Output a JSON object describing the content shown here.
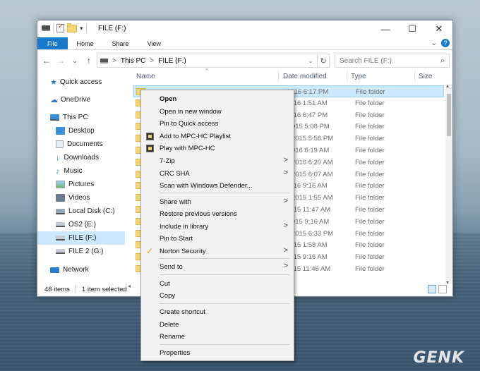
{
  "window": {
    "title": "FILE (F:)",
    "minimize": "—",
    "maximize": "☐",
    "close": "✕"
  },
  "ribbon": {
    "tabs": [
      "File",
      "Home",
      "Share",
      "View"
    ],
    "expand": "⌄",
    "help": "?"
  },
  "address": {
    "back": "←",
    "forward": "→",
    "recent": "⌄",
    "up": "↑",
    "path": [
      "This PC",
      "FILE (F:)"
    ],
    "separator": ">",
    "refresh": "↻",
    "search_placeholder": "Search FILE (F:)"
  },
  "columns": {
    "name": "Name",
    "date": "Date modified",
    "type": "Type",
    "size": "Size"
  },
  "nav": [
    {
      "label": "Quick access",
      "icon": "star-icon",
      "color": "#2a7bd4"
    },
    {
      "label": "OneDrive",
      "icon": "cloud-icon",
      "color": "#2a7bd4"
    },
    {
      "label": "This PC",
      "icon": "computer-icon",
      "color": "#3a8fd8"
    },
    {
      "label": "Desktop",
      "icon": "desktop-icon",
      "color": "#3a8fd8"
    },
    {
      "label": "Documents",
      "icon": "documents-icon",
      "color": "#9aa7b4"
    },
    {
      "label": "Downloads",
      "icon": "downloads-icon",
      "color": "#3a8fd8"
    },
    {
      "label": "Music",
      "icon": "music-icon",
      "color": "#3a8fd8"
    },
    {
      "label": "Pictures",
      "icon": "pictures-icon",
      "color": "#9aa7b4"
    },
    {
      "label": "Videos",
      "icon": "videos-icon",
      "color": "#6b7b8c"
    },
    {
      "label": "Local Disk (C:)",
      "icon": "windows-drive-icon",
      "color": "#5c6a78"
    },
    {
      "label": "OS2 (E:)",
      "icon": "drive-icon",
      "color": "#5c6a78"
    },
    {
      "label": "FILE (F:)",
      "icon": "drive-icon",
      "color": "#5c6a78"
    },
    {
      "label": "FILE 2 (G:)",
      "icon": "drive-icon",
      "color": "#5c6a78"
    },
    {
      "label": "Network",
      "icon": "network-icon",
      "color": "#2a7bd4"
    }
  ],
  "rows": [
    {
      "date": "2016 6:17 PM",
      "type": "File folder"
    },
    {
      "date": "2016 1:51 AM",
      "type": "File folder"
    },
    {
      "date": "2016 6:47 PM",
      "type": "File folder"
    },
    {
      "date": "/2015 5:08 PM",
      "type": "File folder"
    },
    {
      "date": "6/2015 5:56 PM",
      "type": "File folder"
    },
    {
      "date": "/2016 6:19 AM",
      "type": "File folder"
    },
    {
      "date": "5/2016 6:20 AM",
      "type": "File folder"
    },
    {
      "date": "7/2015 6:07 AM",
      "type": "File folder"
    },
    {
      "date": "2016 9:16 AM",
      "type": "File folder"
    },
    {
      "date": "8/2015 1:55 AM",
      "type": "File folder"
    },
    {
      "date": "2015 11:47 AM",
      "type": "File folder"
    },
    {
      "date": "/2015 9:16 AM",
      "type": "File folder"
    },
    {
      "date": "0/2015 6:33 PM",
      "type": "File folder"
    },
    {
      "date": "2015 1:58 AM",
      "type": "File folder"
    },
    {
      "date": "2015 9:16 AM",
      "type": "File folder"
    },
    {
      "date": "2015 11:46 AM",
      "type": "File folder"
    }
  ],
  "status": {
    "count": "48 items",
    "selected": "1 item selected"
  },
  "context_menu": [
    {
      "label": "Open",
      "bold": true
    },
    {
      "label": "Open in new window"
    },
    {
      "label": "Pin to Quick access"
    },
    {
      "label": "Add to MPC-HC Playlist",
      "icon": "mpc-hc-icon"
    },
    {
      "label": "Play with MPC-HC",
      "icon": "mpc-hc-icon"
    },
    {
      "label": "7-Zip",
      "submenu": true
    },
    {
      "label": "CRC SHA",
      "submenu": true
    },
    {
      "label": "Scan with Windows Defender..."
    },
    {
      "label": "Share with",
      "submenu": true
    },
    {
      "label": "Restore previous versions"
    },
    {
      "label": "Include in library",
      "submenu": true
    },
    {
      "label": "Pin to Start"
    },
    {
      "label": "Norton Security",
      "submenu": true,
      "icon": "norton-check-icon"
    },
    {
      "label": "Send to",
      "submenu": true
    },
    {
      "label": "Cut"
    },
    {
      "label": "Copy"
    },
    {
      "label": "Create shortcut"
    },
    {
      "label": "Delete"
    },
    {
      "label": "Rename"
    },
    {
      "label": "Properties"
    }
  ],
  "submenu_arrow": ">",
  "norton_check": "✓",
  "watermark": "GENK"
}
